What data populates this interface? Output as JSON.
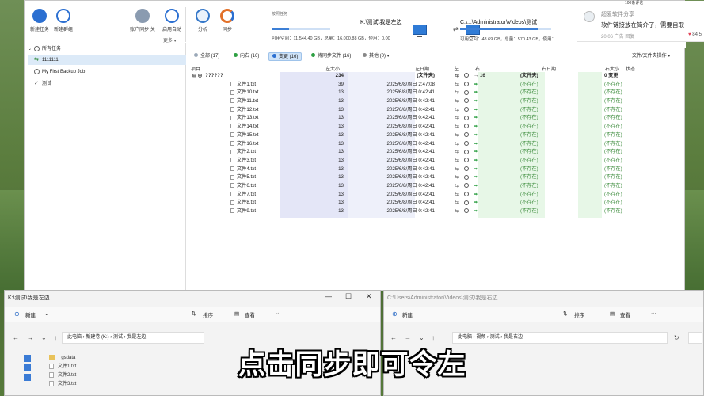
{
  "toolbar": {
    "buttons": [
      {
        "label": "新建任务",
        "icon": "plus-icon"
      },
      {
        "label": "新建群组",
        "icon": "add-group-icon"
      },
      {
        "label": "账户同步 关",
        "icon": "account-sync-icon"
      },
      {
        "label": "启用自动",
        "icon": "clock-icon"
      },
      {
        "label": "分析",
        "icon": "analyze-icon"
      },
      {
        "label": "同步",
        "icon": "sync-icon"
      }
    ],
    "more_label": "更多 ▾"
  },
  "task": {
    "sync_title": "按照任务",
    "left_path": "K:\\测试\\我是左边",
    "right_path": "C:\\...\\Administrator\\Videos\\测试",
    "left_space": "可用空间：11,544.40 GB，总量：16,000.88 GB，使用：0.00",
    "right_space": "可用空间：48.69 GB，总量：570.43 GB，使用：",
    "left_progress": 0.3,
    "right_progress": 0.85
  },
  "notification": {
    "header": "100条评论",
    "user": "超爱软件分享",
    "message": "软件链接放在简介了，需要自取",
    "meta": "20:06  广告  回复",
    "likes": "84.5",
    "heart_symbol": "♥"
  },
  "tree": {
    "all_tasks": "所有任务",
    "items": [
      {
        "label": "1111111",
        "selected": true
      },
      {
        "label": "My First Backup Job",
        "selected": false
      },
      {
        "label": "测试",
        "selected": false
      }
    ]
  },
  "filters": {
    "items": [
      {
        "label": "全部 (17)",
        "color": "#9aa8b8",
        "active": false
      },
      {
        "label": "向右 (16)",
        "color": "#2ea043",
        "active": false
      },
      {
        "label": "变更 (16)",
        "color": "#2b6fd1",
        "active": true
      },
      {
        "label": "待同步文件 (16)",
        "color": "#2ea043",
        "active": false
      },
      {
        "label": "其他 (0) ▾",
        "color": "#888",
        "active": false
      }
    ],
    "folder_ops": "文件/文件夹操作 ▾"
  },
  "columns": {
    "item": "项目",
    "left_size": "左大小",
    "left_date": "左日期",
    "left": "左",
    "right": "右",
    "right_date": "右日期",
    "right_size": "右大小",
    "status": "状态"
  },
  "root_row": {
    "name": "??????",
    "size": "234",
    "date": "(文件夹)",
    "right_count": "→ 16",
    "right_date": "(文件夹)",
    "right_size": "0 变更"
  },
  "files": [
    {
      "name": "文件1.txt",
      "size": "39",
      "date": "2025/6/8/周日 2:47:08"
    },
    {
      "name": "文件10.txt",
      "size": "13",
      "date": "2025/6/8/周日 0:42:41"
    },
    {
      "name": "文件11.txt",
      "size": "13",
      "date": "2025/6/8/周日 0:42:41"
    },
    {
      "name": "文件12.txt",
      "size": "13",
      "date": "2025/6/8/周日 0:42:41"
    },
    {
      "name": "文件13.txt",
      "size": "13",
      "date": "2025/6/8/周日 0:42:41"
    },
    {
      "name": "文件14.txt",
      "size": "13",
      "date": "2025/6/8/周日 0:42:41"
    },
    {
      "name": "文件15.txt",
      "size": "13",
      "date": "2025/6/8/周日 0:42:41"
    },
    {
      "name": "文件16.txt",
      "size": "13",
      "date": "2025/6/8/周日 0:42:41"
    },
    {
      "name": "文件2.txt",
      "size": "13",
      "date": "2025/6/8/周日 0:42:41"
    },
    {
      "name": "文件3.txt",
      "size": "13",
      "date": "2025/6/8/周日 0:42:41"
    },
    {
      "name": "文件4.txt",
      "size": "13",
      "date": "2025/6/8/周日 0:42:41"
    },
    {
      "name": "文件5.txt",
      "size": "13",
      "date": "2025/6/8/周日 0:42:41"
    },
    {
      "name": "文件6.txt",
      "size": "13",
      "date": "2025/6/8/周日 0:42:41"
    },
    {
      "name": "文件7.txt",
      "size": "13",
      "date": "2025/6/8/周日 0:42:41"
    },
    {
      "name": "文件8.txt",
      "size": "13",
      "date": "2025/6/8/周日 0:42:41"
    },
    {
      "name": "文件9.txt",
      "size": "13",
      "date": "2025/6/8/周日 0:42:41"
    }
  ],
  "not_exist": "(不存在)",
  "explorer_left": {
    "title": "K:\\测试\\我是左边",
    "new_label": "新建",
    "sort_label": "排序",
    "view_label": "查看",
    "more": "···",
    "address": "此电脑 › 新建卷 (K:) › 测试 › 我是左边",
    "files": [
      {
        "name": "_gsdata_",
        "type": "folder"
      },
      {
        "name": "文件1.txt",
        "type": "file"
      },
      {
        "name": "文件2.txt",
        "type": "file"
      },
      {
        "name": "文件3.txt",
        "type": "file"
      }
    ]
  },
  "explorer_right": {
    "title": "C:\\Users\\Administrator\\Videos\\测试\\我是右边",
    "new_label": "新建",
    "sort_label": "排序",
    "view_label": "查看",
    "more": "···",
    "address": "此电脑 › 视频 › 测试 › 我是右边"
  },
  "caption": "点击同步即可令左"
}
